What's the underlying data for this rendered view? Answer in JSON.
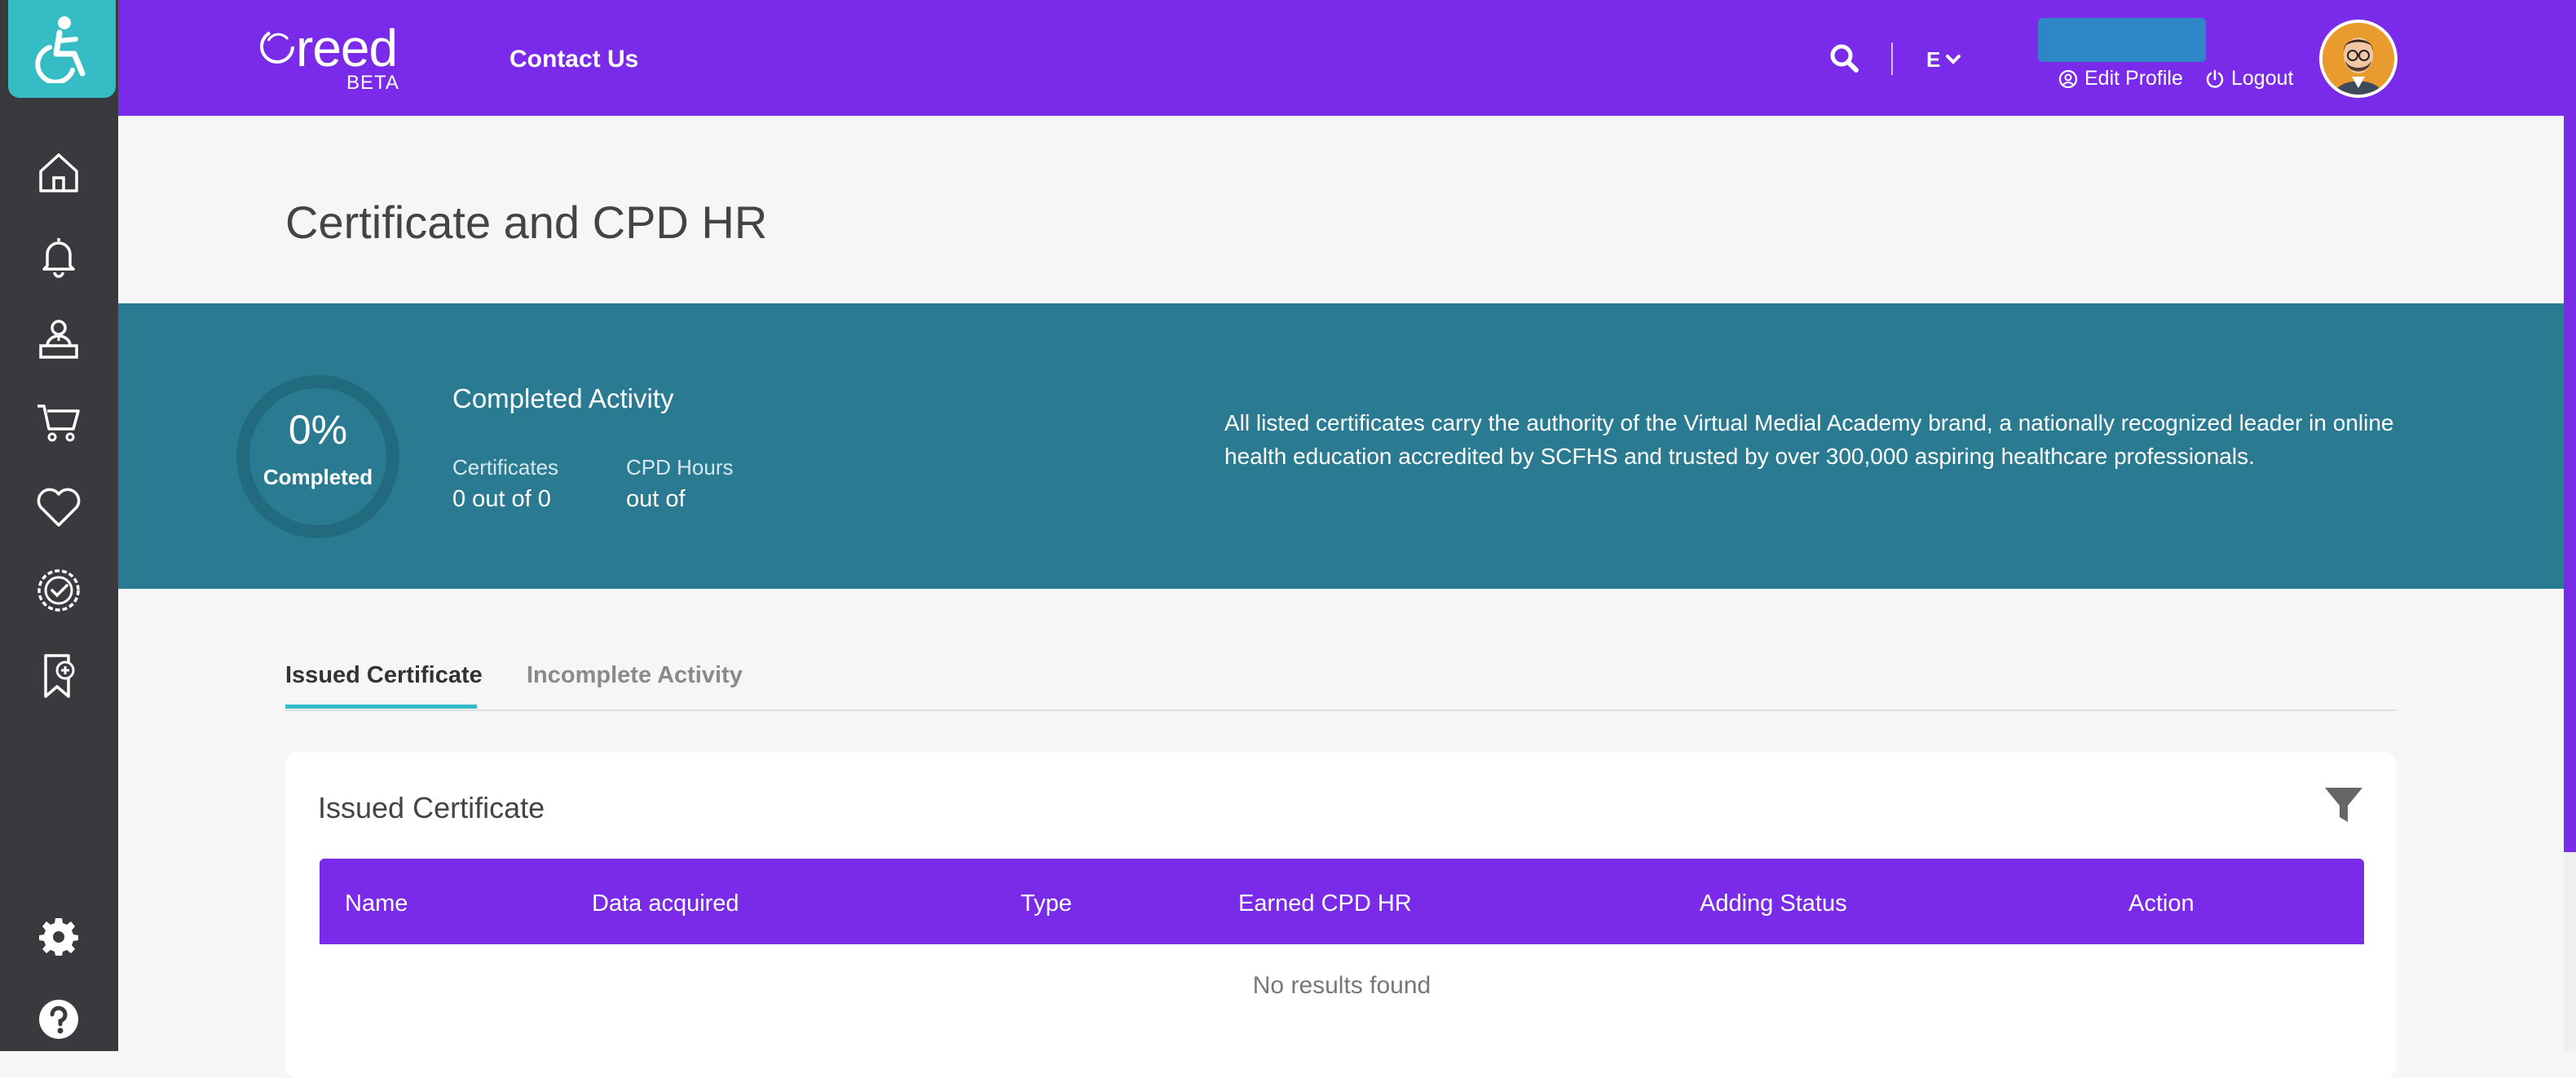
{
  "header": {
    "logo_text": "reed",
    "logo_badge": "BETA",
    "contact_label": "Contact Us",
    "language_label": "E",
    "edit_profile_label": "Edit Profile",
    "logout_label": "Logout"
  },
  "page": {
    "title": "Certificate and CPD HR"
  },
  "summary": {
    "percent": "0%",
    "percent_label": "Completed",
    "section_title": "Completed Activity",
    "certificates_label": "Certificates",
    "certificates_value": "0 out of 0",
    "cpd_label": "CPD Hours",
    "cpd_value": "out of",
    "note": "All listed certificates carry the authority of the Virtual Medial Academy brand, a nationally recognized leader in online health education accredited by SCFHS and trusted by over 300,000 aspiring healthcare professionals."
  },
  "tabs": [
    {
      "label": "Issued Certificate",
      "active": true
    },
    {
      "label": "Incomplete Activity",
      "active": false
    }
  ],
  "card": {
    "title": "Issued Certificate",
    "columns": [
      "Name",
      "Data acquired",
      "Type",
      "Earned CPD HR",
      "Adding Status",
      "Action"
    ],
    "empty_message": "No results found"
  },
  "sidebar": {
    "icons": [
      "home-icon",
      "bell-icon",
      "instructor-icon",
      "cart-icon",
      "heart-icon",
      "badge-check-icon",
      "bookmark-add-icon",
      "gear-icon",
      "help-icon"
    ]
  },
  "colors": {
    "brand_purple": "#7a2bea",
    "teal_banner": "#2a7b91",
    "accent_teal": "#36bcc4",
    "sidebar_dark": "#3a3a3e"
  }
}
